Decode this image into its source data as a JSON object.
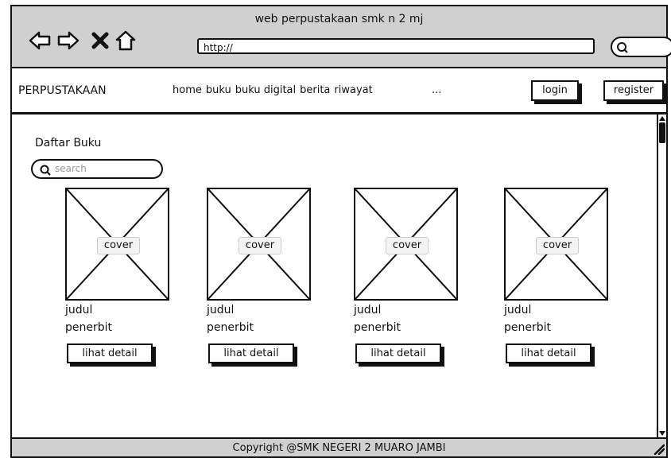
{
  "window": {
    "title": "web perpustakaan smk n 2 mj",
    "url": "http://"
  },
  "header": {
    "brand": "PERPUSTAKAAN",
    "nav": [
      "home",
      "buku",
      "buku digital",
      "berita",
      "riwayat"
    ],
    "more": "...",
    "login_label": "login",
    "register_label": "register"
  },
  "main": {
    "heading": "Daftar Buku",
    "search_placeholder": "search",
    "books": [
      {
        "cover": "cover",
        "title": "judul",
        "publisher": "penerbit",
        "button": "lihat detail"
      },
      {
        "cover": "cover",
        "title": "judul",
        "publisher": "penerbit",
        "button": "lihat detail"
      },
      {
        "cover": "cover",
        "title": "judul",
        "publisher": "penerbit",
        "button": "lihat detail"
      },
      {
        "cover": "cover",
        "title": "judul",
        "publisher": "penerbit",
        "button": "lihat detail"
      }
    ]
  },
  "footer": {
    "text": "Copyright @SMK NEGERI 2 MUARO JAMBI"
  },
  "icons": [
    "back-arrow-icon",
    "forward-arrow-icon",
    "close-icon",
    "home-icon",
    "search-icon",
    "resize-grip-icon"
  ],
  "colors": {
    "chrome": "#d0d0d0",
    "ink": "#111111",
    "placeholder": "#999999"
  }
}
